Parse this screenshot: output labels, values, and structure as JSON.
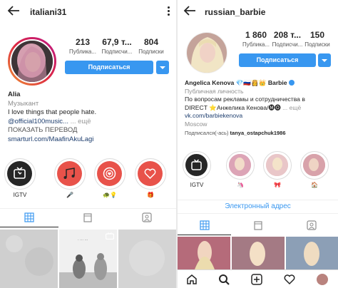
{
  "left": {
    "username": "italiani31",
    "stats": [
      {
        "num": "213",
        "label": "Публика..."
      },
      {
        "num": "67,9 т...",
        "label": "Подписчи..."
      },
      {
        "num": "804",
        "label": "Подписки"
      }
    ],
    "follow_label": "Подписаться",
    "bio": {
      "name": "Alia",
      "category": "Музыкант",
      "line1": "I love things that people hate.",
      "line2_link": "@official100music...",
      "line2_more": " ... ещё",
      "translate": "ПОКАЗАТЬ ПЕРЕВОД",
      "url": "smarturl.com/MaafinAkuLagi"
    },
    "highlights": [
      {
        "label": "IGTV",
        "icon": "igtv-icon"
      },
      {
        "label": "🎤",
        "icon": "music-notes-icon"
      },
      {
        "label": "🐢💡",
        "icon": "heart-target-icon"
      },
      {
        "label": "🎁",
        "icon": "heart-icon"
      }
    ],
    "tabs": [
      "grid-icon",
      "igtv-tab-icon",
      "tagged-icon"
    ],
    "tile_time": "· ··· ···"
  },
  "right": {
    "username": "russian_barbie",
    "stats": [
      {
        "num": "1 860",
        "label": "Публика..."
      },
      {
        "num": "208 т...",
        "label": "Подписчи..."
      },
      {
        "num": "150",
        "label": "Подписки"
      }
    ],
    "follow_label": "Подписаться",
    "bio": {
      "name": "Angelica Kenova 💎🇷🇺👸👑",
      "name_suffix": "Barbie",
      "category": "Публичная личность",
      "line1": "По вопросам рекламы и сотрудничества в",
      "line2": "DIRECT ⭐Анжелика Кенова/🅜🅞",
      "line2_more": " ... ещё",
      "url": "vk.com/barbiekenova",
      "location": "Moscow",
      "followed_prefix": "Подписался(-ась) ",
      "followed_by": "tanya_ostapchuk1986"
    },
    "highlights": [
      {
        "label": "IGTV",
        "icon": "igtv-icon"
      },
      {
        "label": "🦄",
        "icon": "highlight-photo-1"
      },
      {
        "label": "🎀",
        "icon": "highlight-photo-2"
      },
      {
        "label": "🏠",
        "icon": "highlight-photo-3"
      }
    ],
    "email_label": "Электронный адрес",
    "tabs": [
      "grid-icon",
      "igtv-tab-icon",
      "tagged-icon"
    ],
    "nav": [
      "home-icon",
      "search-icon",
      "add-icon",
      "activity-icon",
      "profile-icon"
    ]
  },
  "colors": {
    "accent": "#3897f0",
    "highlight_red": "#e8524a",
    "text": "#262626",
    "muted": "#8e8e8e"
  }
}
